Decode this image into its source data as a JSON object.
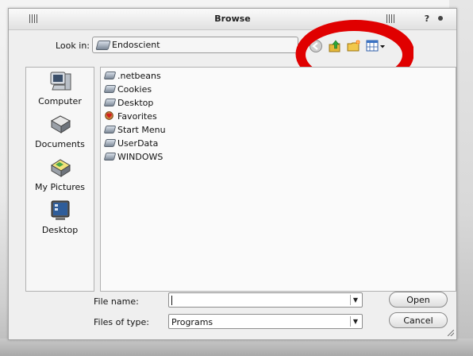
{
  "dialog": {
    "title": "Browse",
    "help_label": "?"
  },
  "look_in": {
    "label": "Look in:",
    "value": "Endoscient"
  },
  "toolbar": {
    "icons": [
      "back-icon",
      "up-folder-icon",
      "new-folder-icon",
      "view-menu-icon"
    ]
  },
  "places": [
    {
      "label": "Computer",
      "icon": "computer-icon"
    },
    {
      "label": "Documents",
      "icon": "documents-icon"
    },
    {
      "label": "My Pictures",
      "icon": "pictures-icon"
    },
    {
      "label": "Desktop",
      "icon": "desktop-icon"
    }
  ],
  "files": [
    {
      "name": ".netbeans",
      "icon": "drive-folder-icon"
    },
    {
      "name": "Cookies",
      "icon": "drive-folder-icon"
    },
    {
      "name": "Desktop",
      "icon": "drive-folder-icon"
    },
    {
      "name": "Favorites",
      "icon": "favorites-icon"
    },
    {
      "name": "Start Menu",
      "icon": "drive-folder-icon"
    },
    {
      "name": "UserData",
      "icon": "drive-folder-icon"
    },
    {
      "name": "WINDOWS",
      "icon": "drive-folder-icon"
    }
  ],
  "filename": {
    "label": "File name:",
    "value": ""
  },
  "filetype": {
    "label": "Files of type:",
    "value": "Programs"
  },
  "buttons": {
    "open": "Open",
    "cancel": "Cancel"
  },
  "colors": {
    "annotation": "#e00000"
  }
}
